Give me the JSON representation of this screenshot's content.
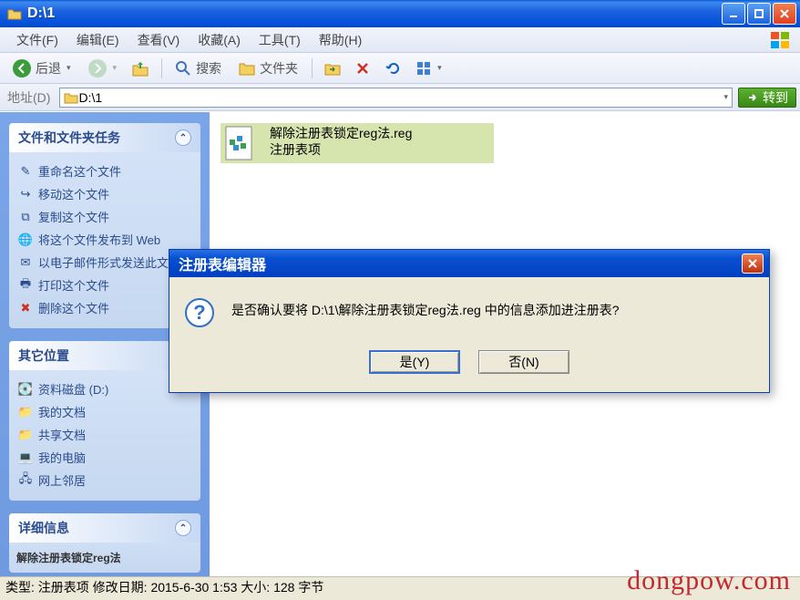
{
  "window": {
    "title": "D:\\1"
  },
  "menu": {
    "file": "文件(F)",
    "edit": "编辑(E)",
    "view": "查看(V)",
    "fav": "收藏(A)",
    "tools": "工具(T)",
    "help": "帮助(H)"
  },
  "toolbar": {
    "back": "后退",
    "search": "搜索",
    "folders": "文件夹"
  },
  "address": {
    "label": "地址(D)",
    "path": "D:\\1",
    "go": "转到"
  },
  "sidepanel": {
    "tasks": {
      "header": "文件和文件夹任务",
      "rename": "重命名这个文件",
      "move": "移动这个文件",
      "copy": "复制这个文件",
      "publish": "将这个文件发布到 Web",
      "email": "以电子邮件形式发送此文件",
      "print": "打印这个文件",
      "delete": "删除这个文件"
    },
    "other": {
      "header": "其它位置",
      "datadisk": "资料磁盘 (D:)",
      "mydocs": "我的文档",
      "shared": "共享文档",
      "mycomputer": "我的电脑",
      "network": "网上邻居"
    },
    "details": {
      "header": "详细信息",
      "fname": "解除注册表锁定reg法"
    }
  },
  "file": {
    "name": "解除注册表锁定reg法.reg",
    "type_line": "注册表项"
  },
  "dialog": {
    "title": "注册表编辑器",
    "message": "是否确认要将 D:\\1\\解除注册表锁定reg法.reg 中的信息添加进注册表?",
    "yes": "是(Y)",
    "no": "否(N)"
  },
  "statusbar": "类型: 注册表项 修改日期: 2015-6-30 1:53 大小: 128 字节",
  "watermark": "dongpow.com"
}
